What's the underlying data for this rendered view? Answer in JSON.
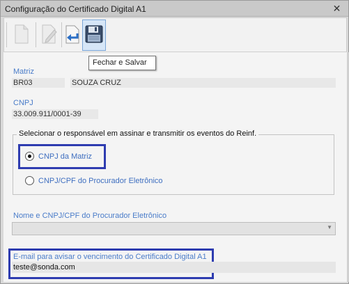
{
  "window": {
    "title": "Configuração do Certificado Digital A1",
    "close_glyph": "✕"
  },
  "toolbar": {
    "buttons": [
      {
        "name": "new-document-icon",
        "state": "disabled"
      },
      {
        "name": "edit-document-icon",
        "state": "disabled"
      },
      {
        "name": "undo-arrow-icon",
        "state": "enabled"
      },
      {
        "name": "save-floppy-icon",
        "state": "hover"
      }
    ],
    "tooltip": "Fechar e Salvar"
  },
  "matriz": {
    "label": "Matriz",
    "code": "BR03",
    "name": "SOUZA CRUZ"
  },
  "cnpj": {
    "label": "CNPJ",
    "value": "33.009.911/0001-39"
  },
  "responsavel": {
    "legend": "Selecionar o responsável em assinar e transmitir os eventos do Reinf.",
    "options": [
      {
        "label": "CNPJ da Matriz",
        "checked": true
      },
      {
        "label": "CNPJ/CPF do Procurador Eletrônico",
        "checked": false
      }
    ]
  },
  "procurador": {
    "label": "Nome e CNPJ/CPF do Procurador Eletrônico",
    "value": ""
  },
  "email": {
    "label": "E-mail para avisar o vencimento do Certificado Digital A1",
    "value": "teste@sonda.com"
  },
  "colors": {
    "accent_label": "#4a7cc9",
    "highlight_border": "#2e3cb0",
    "radio_label": "#3f6fc0"
  }
}
